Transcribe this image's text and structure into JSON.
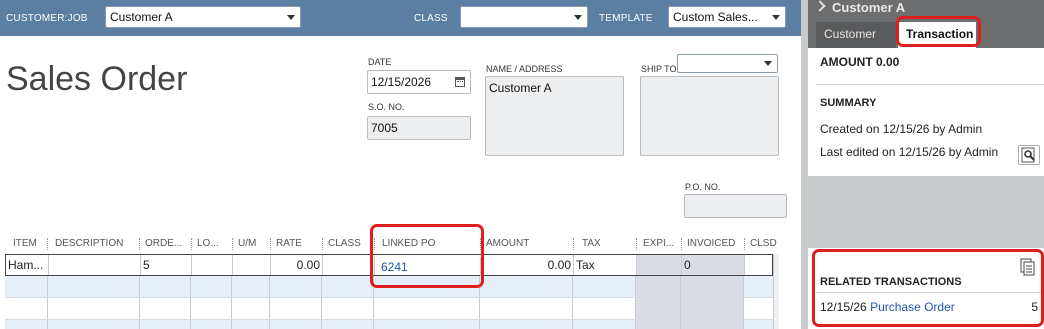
{
  "header": {
    "customer_job_label": "CUSTOMER:JOB",
    "customer_job_value": "Customer A",
    "class_label": "CLASS",
    "class_value": "",
    "template_label": "TEMPLATE",
    "template_value": "Custom Sales..."
  },
  "form": {
    "title": "Sales Order",
    "date_label": "DATE",
    "date_value": "12/15/2026",
    "so_no_label": "S.O. NO.",
    "so_no_value": "7005",
    "name_address_label": "NAME / ADDRESS",
    "name_address_value": "Customer A",
    "ship_to_label": "SHIP TO",
    "ship_to_value": "",
    "po_no_label": "P.O. NO.",
    "po_no_value": ""
  },
  "table": {
    "columns": [
      "ITEM",
      "DESCRIPTION",
      "ORDE...",
      "LO...",
      "U/M",
      "RATE",
      "CLASS",
      "LINKED PO",
      "AMOUNT",
      "TAX",
      "EXPI...",
      "INVOICED",
      "CLSD"
    ],
    "rows": [
      {
        "item": "Ham...",
        "description": "",
        "ordered": "5",
        "lo": "",
        "um": "",
        "rate": "0.00",
        "class": "",
        "linked_po": "6241",
        "amount": "0.00",
        "tax": "Tax",
        "expi": "",
        "invoiced": "0",
        "clsd": ""
      }
    ]
  },
  "panel": {
    "title": "Customer A",
    "tabs": [
      "Customer",
      "Transaction"
    ],
    "active_tab": "Transaction",
    "amount_text": "AMOUNT 0.00",
    "summary_heading": "SUMMARY",
    "created_text": "Created on 12/15/26  by  Admin",
    "edited_text": "Last edited on 12/15/26 by Admin",
    "related_heading": "RELATED TRANSACTIONS",
    "related": [
      {
        "date": "12/15/26",
        "type": "Purchase Order",
        "number": "5"
      }
    ]
  },
  "colors": {
    "header_bar": "#5b7ea3",
    "panel_header": "#6d6e70",
    "highlight": "#e01e1e",
    "link": "#2255aa"
  }
}
